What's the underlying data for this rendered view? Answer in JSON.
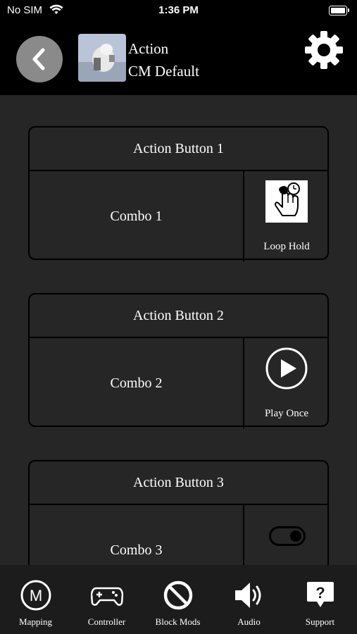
{
  "status_bar": {
    "carrier": "No SIM",
    "time": "1:36 PM"
  },
  "header": {
    "title_line1": "Action",
    "title_line2": "CM Default"
  },
  "cards": [
    {
      "title": "Action Button 1",
      "combo": "Combo 1",
      "mode": "Loop Hold"
    },
    {
      "title": "Action Button 2",
      "combo": "Combo 2",
      "mode": "Play Once"
    },
    {
      "title": "Action Button 3",
      "combo": "Combo 3",
      "mode": ""
    }
  ],
  "tabs": [
    {
      "label": "Mapping",
      "icon": "mapping-icon"
    },
    {
      "label": "Controller",
      "icon": "controller-icon"
    },
    {
      "label": "Block Mods",
      "icon": "block-icon"
    },
    {
      "label": "Audio",
      "icon": "speaker-icon"
    },
    {
      "label": "Support",
      "icon": "support-icon"
    }
  ]
}
